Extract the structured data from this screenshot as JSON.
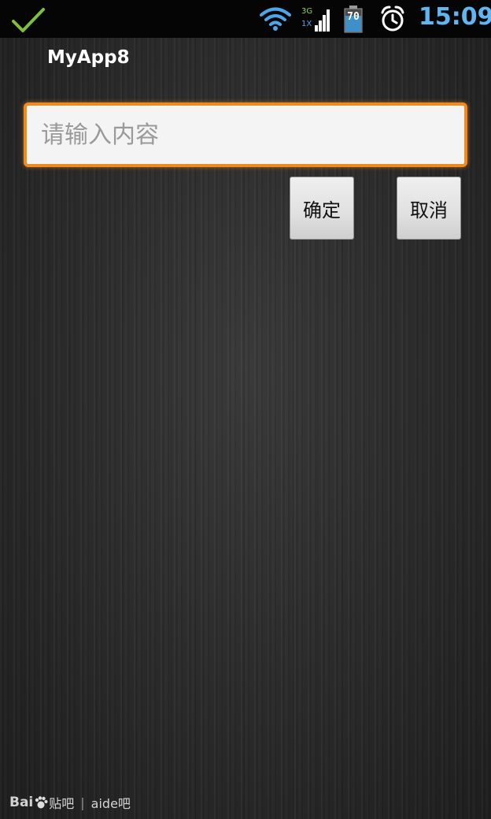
{
  "status_bar": {
    "icons": {
      "notification": "check-icon",
      "wifi": "wifi-icon",
      "signal": "signal-icon",
      "battery": "battery-icon",
      "alarm": "alarm-clock-icon"
    },
    "network_labels": [
      "3G",
      "1X"
    ],
    "battery_level": "70",
    "time": "15:09"
  },
  "app": {
    "title": "MyApp8"
  },
  "form": {
    "input": {
      "value": "",
      "placeholder": "请输入内容"
    },
    "ok_label": "确定",
    "cancel_label": "取消"
  },
  "watermark": {
    "logo_left": "Bai",
    "logo_right": "贴吧",
    "separator": "|",
    "forum": "aide吧"
  },
  "colors": {
    "status_bar_bg": "#050505",
    "clock": "#5fb6f3",
    "input_focus_border": "#ef8a1c",
    "notification_check": "#7ec03c"
  }
}
